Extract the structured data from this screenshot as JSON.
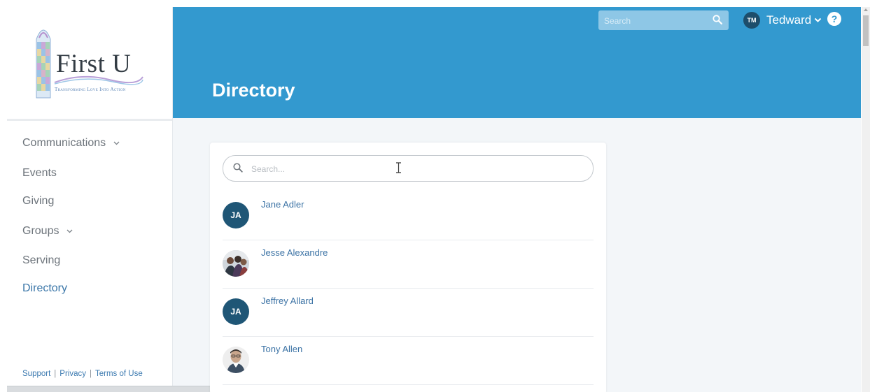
{
  "brand": {
    "name": "First U",
    "tagline": "Transforming Love Into Action"
  },
  "colors": {
    "header_bg": "#3399cf",
    "link_blue": "#3c73a5",
    "avatar_navy": "#1f5676",
    "nav_active": "#3a76a8"
  },
  "nav": {
    "items": [
      {
        "label": "Communications",
        "has_dropdown": true
      },
      {
        "label": "Events",
        "has_dropdown": false
      },
      {
        "label": "Giving",
        "has_dropdown": false
      },
      {
        "label": "Groups",
        "has_dropdown": true
      },
      {
        "label": "Serving",
        "has_dropdown": false
      },
      {
        "label": "Directory",
        "has_dropdown": false,
        "active": true
      }
    ]
  },
  "footer": {
    "support": "Support",
    "sep": "|",
    "privacy": "Privacy",
    "terms": "Terms of Use"
  },
  "header": {
    "title": "Directory",
    "search_placeholder": "Search",
    "user_initials": "TM",
    "user_name": "Tedward",
    "help_symbol": "?"
  },
  "directory": {
    "search_placeholder": "Search...",
    "people": [
      {
        "name": "Jane Adler",
        "initials": "JA",
        "avatar": "initials"
      },
      {
        "name": "Jesse Alexandre",
        "initials": "",
        "avatar": "photo-group-icon"
      },
      {
        "name": "Jeffrey Allard",
        "initials": "JA",
        "avatar": "initials"
      },
      {
        "name": "Tony Allen",
        "initials": "",
        "avatar": "photo-person-icon"
      }
    ]
  }
}
